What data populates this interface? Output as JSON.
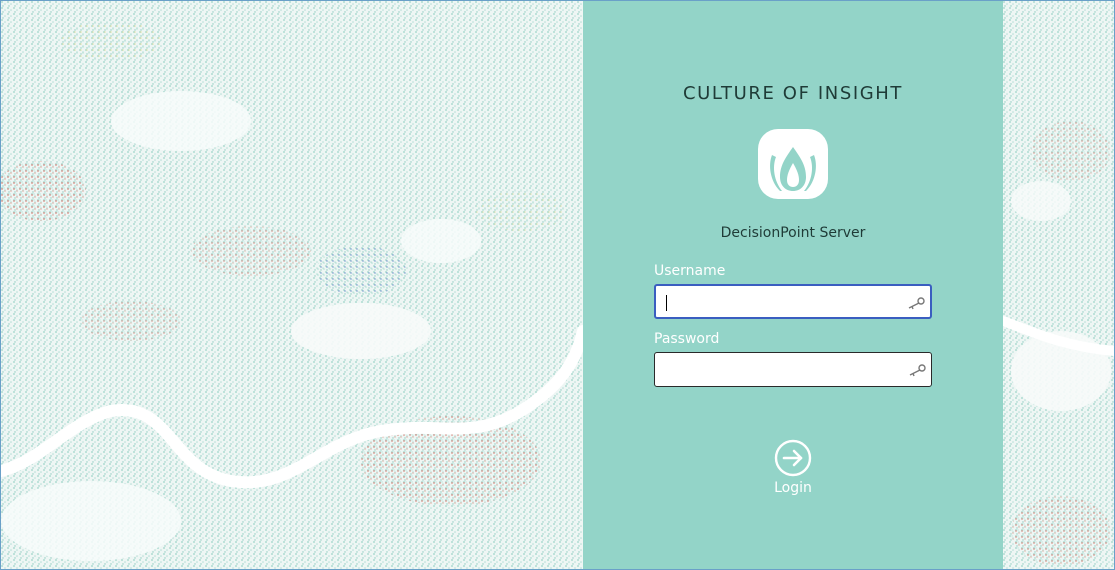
{
  "brand": {
    "title": "CULTURE OF INSIGHT",
    "logo_icon": "culture-of-insight-logo"
  },
  "app": {
    "name": "DecisionPoint Server"
  },
  "form": {
    "username": {
      "label": "Username",
      "value": "",
      "placeholder": "",
      "focused": true,
      "icon": "key-icon"
    },
    "password": {
      "label": "Password",
      "value": "",
      "placeholder": "",
      "icon": "key-icon"
    },
    "login": {
      "label": "Login",
      "icon": "arrow-right-circle-icon"
    }
  },
  "colors": {
    "panel": "#93d4c8",
    "map_base": "#eef6f4",
    "map_green": "#8fcfc3",
    "map_red": "#d7756a",
    "map_blue": "#5a7fc4",
    "map_yellow": "#e4d67a",
    "focus_border": "#3a5ec0"
  }
}
